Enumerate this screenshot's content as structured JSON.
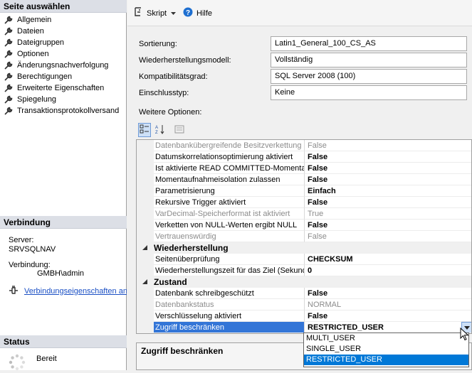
{
  "left_panel": {
    "select_page_header": "Seite auswählen",
    "pages": [
      {
        "label": "Allgemein"
      },
      {
        "label": "Dateien"
      },
      {
        "label": "Dateigruppen"
      },
      {
        "label": "Optionen"
      },
      {
        "label": "Änderungsnachverfolgung"
      },
      {
        "label": "Berechtigungen"
      },
      {
        "label": "Erweiterte Eigenschaften"
      },
      {
        "label": "Spiegelung"
      },
      {
        "label": "Transaktionsprotokollversand"
      }
    ],
    "connection_header": "Verbindung",
    "server_label": "Server:",
    "server_value": "SRVSQLNAV",
    "connection_label": "Verbindung:",
    "connection_value": "GMBH\\admin",
    "connection_link": "Verbindungseigenschaften anzeigen",
    "status_header": "Status",
    "status_value": "Bereit"
  },
  "toolbar": {
    "script_label": "Skript",
    "help_label": "Hilfe"
  },
  "form": {
    "sort_label": "Sortierung:",
    "sort_value": "Latin1_General_100_CS_AS",
    "recovery_label": "Wiederherstellungsmodell:",
    "recovery_value": "Vollständig",
    "compat_label": "Kompatibilitätsgrad:",
    "compat_value": "SQL Server 2008 (100)",
    "containment_label": "Einschlusstyp:",
    "containment_value": "Keine",
    "more_options_label": "Weitere Optionen:"
  },
  "grid": {
    "rows": [
      {
        "name": "Datenbankübergreifende Besitzverkettung aktiviert",
        "value": "False",
        "disabled": true
      },
      {
        "name": "Datumskorrelationsoptimierung aktiviert",
        "value": "False"
      },
      {
        "name": "Ist aktivierte READ COMMITTED-Momentaufnahme",
        "value": "False"
      },
      {
        "name": "Momentaufnahmeisolation zulassen",
        "value": "False"
      },
      {
        "name": "Parametrisierung",
        "value": "Einfach"
      },
      {
        "name": "Rekursive Trigger aktiviert",
        "value": "False"
      },
      {
        "name": "VarDecimal-Speicherformat ist aktiviert",
        "value": "True",
        "disabled": true
      },
      {
        "name": "Verketten von NULL-Werten ergibt NULL",
        "value": "False"
      },
      {
        "name": "Vertrauenswürdig",
        "value": "False",
        "disabled": true
      }
    ],
    "category_recovery": "Wiederherstellung",
    "recovery_rows": [
      {
        "name": "Seitenüberprüfung",
        "value": "CHECKSUM"
      },
      {
        "name": "Wiederherstellungszeit für das Ziel (Sekunden)",
        "value": "0"
      }
    ],
    "category_state": "Zustand",
    "state_rows": [
      {
        "name": "Datenbank schreibgeschützt",
        "value": "False"
      },
      {
        "name": "Datenbankstatus",
        "value": "NORMAL",
        "disabled": true
      },
      {
        "name": "Verschlüsselung aktiviert",
        "value": "False"
      }
    ],
    "selected_row": {
      "name": "Zugriff beschränken",
      "value": "RESTRICTED_USER"
    }
  },
  "dropdown": {
    "options": [
      "MULTI_USER",
      "SINGLE_USER",
      "RESTRICTED_USER"
    ],
    "selected_index": 2
  },
  "description": {
    "title": "Zugriff beschränken"
  },
  "colors": {
    "selection": "#3375d7",
    "dropdown_selection": "#0078d7",
    "link": "#1a4fc4"
  }
}
